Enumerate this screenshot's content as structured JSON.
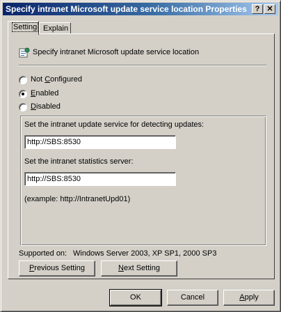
{
  "window": {
    "title": "Specify intranet Microsoft update service location Properties",
    "help_glyph": "?",
    "close_glyph": "✕"
  },
  "tabs": [
    {
      "label": "Setting",
      "active": true
    },
    {
      "label": "Explain",
      "active": false
    }
  ],
  "setting": {
    "policy_icon": "policy-setting-icon",
    "policy_name": "Specify intranet Microsoft update service location",
    "options": [
      {
        "label": "Not Configured",
        "accesskey": "C",
        "selected": false
      },
      {
        "label": "Enabled",
        "accesskey": "E",
        "selected": true
      },
      {
        "label": "Disabled",
        "accesskey": "D",
        "selected": false
      }
    ],
    "update_service_label": "Set the intranet update service for detecting updates:",
    "update_service_value": "http://SBS:8530",
    "statistics_server_label": "Set the intranet statistics server:",
    "statistics_server_value": "http://SBS:8530",
    "example_text": "(example: http://IntranetUpd01)",
    "supported_label": "Supported on:",
    "supported_value": "Windows Server 2003, XP SP1, 2000 SP3"
  },
  "nav": {
    "previous": "Previous Setting",
    "previous_key": "P",
    "next": "Next Setting",
    "next_key": "N"
  },
  "buttons": {
    "ok": "OK",
    "cancel": "Cancel",
    "apply": "Apply",
    "apply_key": "A"
  }
}
